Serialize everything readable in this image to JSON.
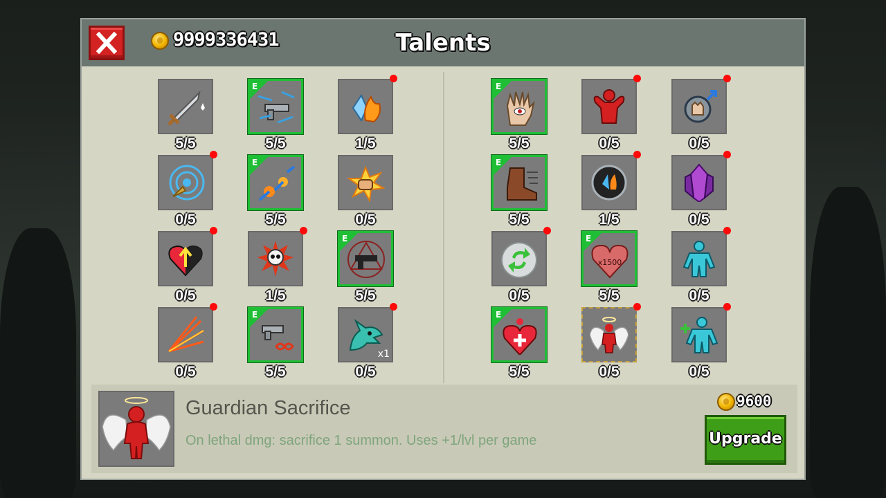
{
  "header": {
    "title": "Talents",
    "currency": "9999336431",
    "close_icon": "close-x-icon",
    "coin_icon": "skull-coin-icon"
  },
  "talents_left": [
    {
      "id": "sword",
      "level": "5/5",
      "equipped": false,
      "notify": false,
      "icon": "sword-icon"
    },
    {
      "id": "gun-speed",
      "level": "5/5",
      "equipped": true,
      "notify": false,
      "icon": "gun-speed-icon"
    },
    {
      "id": "fire-ice",
      "level": "1/5",
      "equipped": false,
      "notify": true,
      "icon": "fire-ice-crystal-icon"
    },
    {
      "id": "target",
      "level": "0/5",
      "equipped": false,
      "notify": true,
      "icon": "target-bullet-icon"
    },
    {
      "id": "fireballs",
      "level": "5/5",
      "equipped": true,
      "notify": false,
      "icon": "fireballs-icon"
    },
    {
      "id": "punch",
      "level": "0/5",
      "equipped": false,
      "notify": false,
      "icon": "punch-burst-icon"
    },
    {
      "id": "heart-up",
      "level": "0/5",
      "equipped": false,
      "notify": true,
      "icon": "heart-arrow-up-icon"
    },
    {
      "id": "skull-burst",
      "level": "1/5",
      "equipped": false,
      "notify": true,
      "icon": "skull-burst-icon"
    },
    {
      "id": "pistol-rune",
      "level": "5/5",
      "equipped": true,
      "notify": false,
      "icon": "pistol-rune-icon"
    },
    {
      "id": "spread-shot",
      "level": "0/5",
      "equipped": false,
      "notify": true,
      "icon": "spread-shot-icon"
    },
    {
      "id": "infinite-ammo",
      "level": "5/5",
      "equipped": true,
      "notify": false,
      "icon": "gun-infinity-icon"
    },
    {
      "id": "dragon",
      "level": "0/5",
      "equipped": false,
      "notify": true,
      "icon": "dragon-head-icon",
      "mult": "x1"
    }
  ],
  "talents_right": [
    {
      "id": "eye-hand",
      "level": "5/5",
      "equipped": true,
      "notify": false,
      "icon": "eye-hand-icon"
    },
    {
      "id": "muscle",
      "level": "0/5",
      "equipped": false,
      "notify": true,
      "icon": "red-muscle-man-icon"
    },
    {
      "id": "orb-hand",
      "level": "0/5",
      "equipped": false,
      "notify": true,
      "icon": "orb-hand-up-icon"
    },
    {
      "id": "boot",
      "level": "5/5",
      "equipped": true,
      "notify": false,
      "icon": "speed-boot-icon"
    },
    {
      "id": "elemental-orb",
      "level": "1/5",
      "equipped": false,
      "notify": true,
      "icon": "elemental-orb-icon"
    },
    {
      "id": "crystal",
      "level": "0/5",
      "equipped": false,
      "notify": true,
      "icon": "purple-crystal-icon"
    },
    {
      "id": "regen-shield",
      "level": "0/5",
      "equipped": false,
      "notify": true,
      "icon": "regen-shield-icon"
    },
    {
      "id": "heart-1500",
      "level": "5/5",
      "equipped": true,
      "notify": false,
      "icon": "heart-x1500-icon",
      "badge": "x1500"
    },
    {
      "id": "clone",
      "level": "0/5",
      "equipped": false,
      "notify": true,
      "icon": "cyan-figure-icon"
    },
    {
      "id": "heal-heart",
      "level": "5/5",
      "equipped": true,
      "notify": false,
      "icon": "heal-heart-icon"
    },
    {
      "id": "guardian",
      "level": "0/5",
      "equipped": false,
      "notify": true,
      "selected": true,
      "icon": "guardian-angel-icon"
    },
    {
      "id": "summon-plus",
      "level": "0/5",
      "equipped": false,
      "notify": true,
      "icon": "cyan-figure-plus-icon"
    }
  ],
  "detail": {
    "name": "Guardian Sacrifice",
    "description": "On lethal dmg: sacrifice 1 summon. Uses +1/lvl per game",
    "price": "9600",
    "upgrade_label": "Upgrade",
    "icon": "guardian-angel-icon"
  },
  "colors": {
    "panel": "#d6d6c4",
    "header": "#6b7670",
    "equipped_border": "#1fbf35",
    "notify_dot": "#ff0a0a",
    "upgrade": "#3f9e18",
    "close": "#d32222"
  }
}
